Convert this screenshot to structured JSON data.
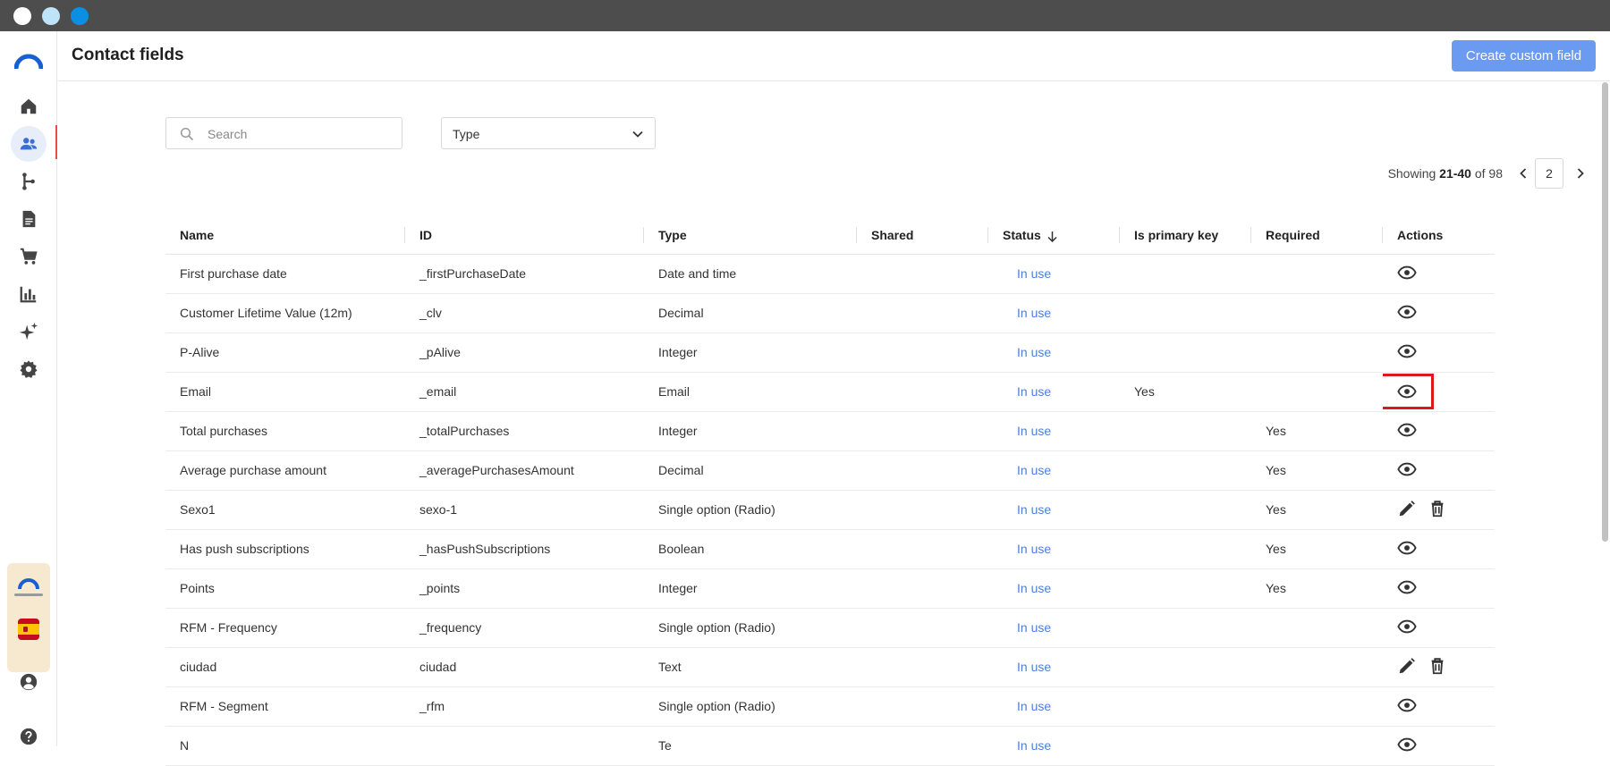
{
  "header": {
    "title": "Contact fields",
    "create_label": "Create custom field"
  },
  "filters": {
    "search_placeholder": "Search",
    "type_label": "Type"
  },
  "pager": {
    "prefix": "Showing ",
    "range": "21-40",
    "suffix": " of 98",
    "page": "2"
  },
  "columns": [
    "Name",
    "ID",
    "Type",
    "Shared",
    "Status",
    "Is primary key",
    "Required",
    "Actions"
  ],
  "rows": [
    {
      "name": "First purchase date",
      "id": "_firstPurchaseDate",
      "type": "Date and time",
      "shared": "",
      "status": "In use",
      "primary": "",
      "required": "",
      "actions": "view"
    },
    {
      "name": "Customer Lifetime Value (12m)",
      "id": "_clv",
      "type": "Decimal",
      "shared": "",
      "status": "In use",
      "primary": "",
      "required": "",
      "actions": "view"
    },
    {
      "name": "P-Alive",
      "id": "_pAlive",
      "type": "Integer",
      "shared": "",
      "status": "In use",
      "primary": "",
      "required": "",
      "actions": "view"
    },
    {
      "name": "Email",
      "id": "_email",
      "type": "Email",
      "shared": "",
      "status": "In use",
      "primary": "Yes",
      "required": "",
      "actions": "view",
      "highlighted": true
    },
    {
      "name": "Total purchases",
      "id": "_totalPurchases",
      "type": "Integer",
      "shared": "",
      "status": "In use",
      "primary": "",
      "required": "Yes",
      "actions": "view"
    },
    {
      "name": "Average purchase amount",
      "id": "_averagePurchasesAmount",
      "type": "Decimal",
      "shared": "",
      "status": "In use",
      "primary": "",
      "required": "Yes",
      "actions": "view"
    },
    {
      "name": "Sexo1",
      "id": "sexo-1",
      "type": "Single option (Radio)",
      "shared": "",
      "status": "In use",
      "primary": "",
      "required": "Yes",
      "actions": "edit-delete"
    },
    {
      "name": "Has push subscriptions",
      "id": "_hasPushSubscriptions",
      "type": "Boolean",
      "shared": "",
      "status": "In use",
      "primary": "",
      "required": "Yes",
      "actions": "view"
    },
    {
      "name": "Points",
      "id": "_points",
      "type": "Integer",
      "shared": "",
      "status": "In use",
      "primary": "",
      "required": "Yes",
      "actions": "view"
    },
    {
      "name": "RFM - Frequency",
      "id": "_frequency",
      "type": "Single option (Radio)",
      "shared": "",
      "status": "In use",
      "primary": "",
      "required": "",
      "actions": "view"
    },
    {
      "name": "ciudad",
      "id": "ciudad",
      "type": "Text",
      "shared": "",
      "status": "In use",
      "primary": "",
      "required": "",
      "actions": "edit-delete"
    },
    {
      "name": "RFM - Segment",
      "id": "_rfm",
      "type": "Single option (Radio)",
      "shared": "",
      "status": "In use",
      "primary": "",
      "required": "",
      "actions": "view"
    },
    {
      "name": "N",
      "id": "",
      "type": "Te",
      "shared": "",
      "status": "In use",
      "primary": "",
      "required": "",
      "actions": "view"
    }
  ],
  "sidebar": {
    "items": [
      {
        "icon": "home-icon"
      },
      {
        "icon": "contacts-icon",
        "active": true
      },
      {
        "icon": "flow-icon"
      },
      {
        "icon": "document-icon"
      },
      {
        "icon": "cart-icon"
      },
      {
        "icon": "chart-icon"
      },
      {
        "icon": "sparkle-icon"
      },
      {
        "icon": "gear-icon"
      }
    ]
  },
  "colors": {
    "accent": "#6b9bf0",
    "status": "#4a7fd8",
    "highlight": "#d9191c"
  }
}
